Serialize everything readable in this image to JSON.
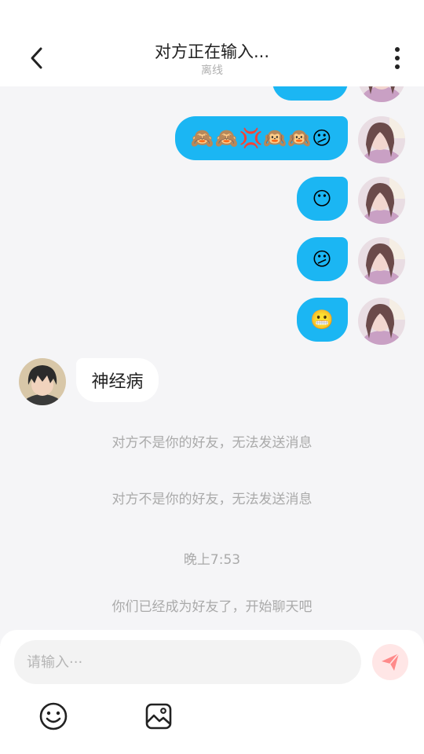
{
  "header": {
    "title": "对方正在输入...",
    "status": "离线"
  },
  "messages": [
    {
      "from": "me",
      "content": "🙈🙈💢🙉🙉😕"
    },
    {
      "from": "me",
      "content": "😶"
    },
    {
      "from": "me",
      "content": "😕"
    },
    {
      "from": "me",
      "content": "😬"
    },
    {
      "from": "other",
      "content": "神经病"
    }
  ],
  "system": {
    "notice_1": "对方不是你的好友，无法发送消息",
    "notice_2": "对方不是你的好友，无法发送消息",
    "time": "晚上7:53",
    "friend_notice": "你们已经成为好友了，开始聊天吧"
  },
  "composer": {
    "placeholder": "请输入···"
  },
  "colors": {
    "my_bubble": "#1bb6f3",
    "other_bubble": "#ffffff",
    "send_button": "#ffe6e6",
    "send_icon": "#ff8a8a"
  },
  "icons": [
    "back-arrow-icon",
    "more-vertical-icon",
    "send-icon",
    "emoji-icon",
    "image-icon"
  ]
}
